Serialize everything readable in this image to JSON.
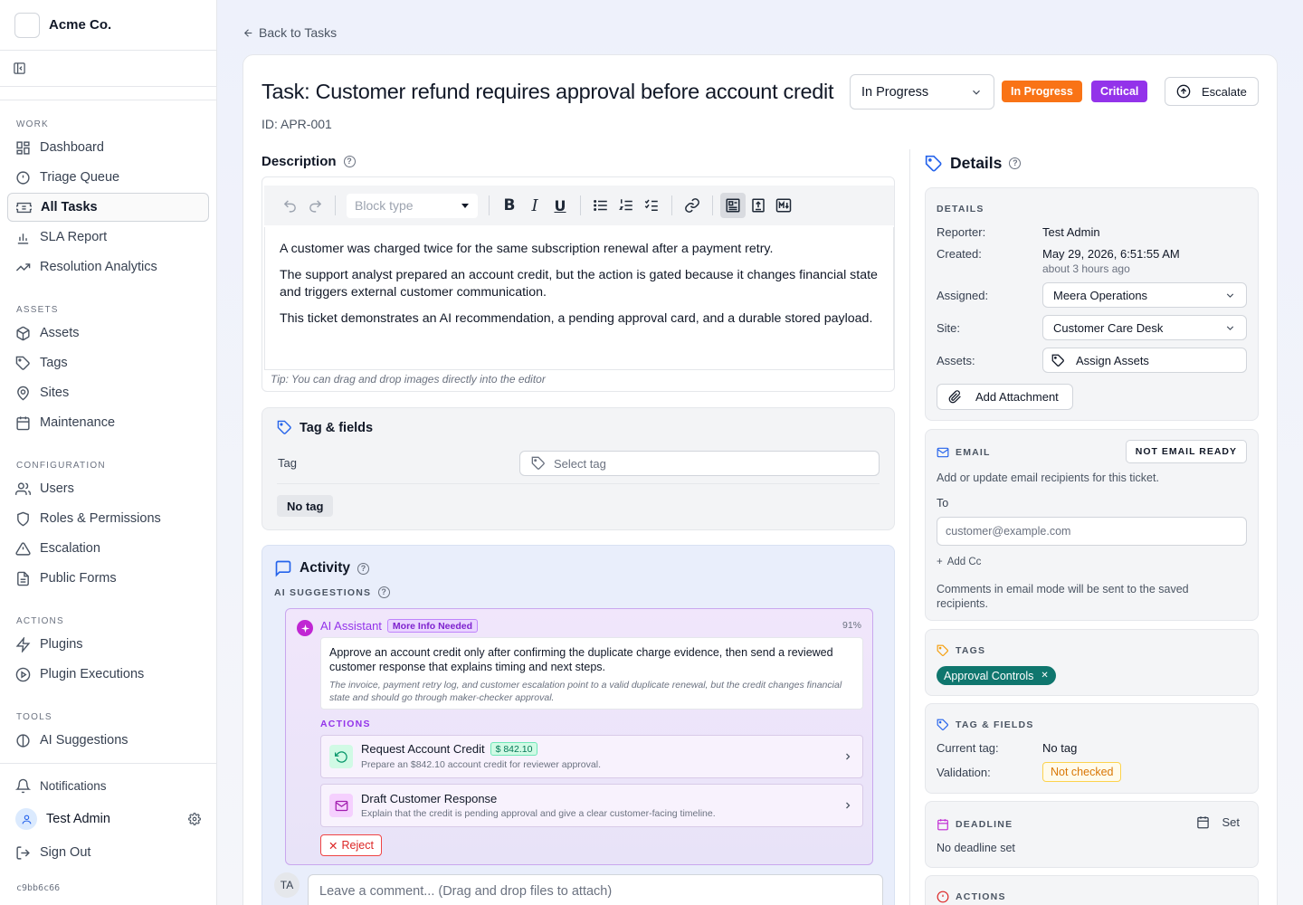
{
  "app": {
    "name": "Acme Co.",
    "build_hash": "c9bb6c66"
  },
  "sidebar": {
    "sections": [
      {
        "title": "WORK",
        "items": [
          {
            "label": "Dashboard",
            "icon": "dashboard-icon"
          },
          {
            "label": "Triage Queue",
            "icon": "alert-circle-icon"
          },
          {
            "label": "All Tasks",
            "icon": "ticket-icon",
            "active": true
          },
          {
            "label": "SLA Report",
            "icon": "bar-chart-icon"
          },
          {
            "label": "Resolution Analytics",
            "icon": "trending-up-icon"
          }
        ]
      },
      {
        "title": "ASSETS",
        "items": [
          {
            "label": "Assets",
            "icon": "box-icon"
          },
          {
            "label": "Tags",
            "icon": "tag-icon"
          },
          {
            "label": "Sites",
            "icon": "map-pin-icon"
          },
          {
            "label": "Maintenance",
            "icon": "calendar-icon"
          }
        ]
      },
      {
        "title": "CONFIGURATION",
        "items": [
          {
            "label": "Users",
            "icon": "users-icon"
          },
          {
            "label": "Roles & Permissions",
            "icon": "shield-icon"
          },
          {
            "label": "Escalation",
            "icon": "warning-triangle-icon"
          },
          {
            "label": "Public Forms",
            "icon": "file-text-icon"
          }
        ]
      },
      {
        "title": "ACTIONS",
        "items": [
          {
            "label": "Plugins",
            "icon": "zap-icon"
          },
          {
            "label": "Plugin Executions",
            "icon": "play-circle-icon"
          }
        ]
      },
      {
        "title": "TOOLS",
        "items": [
          {
            "label": "AI Suggestions",
            "icon": "ai-icon"
          }
        ]
      }
    ],
    "notifications_label": "Notifications",
    "user_name": "Test Admin",
    "sign_out_label": "Sign Out"
  },
  "header": {
    "back_label": "Back to Tasks",
    "title": "Task: Customer refund requires approval before account credit",
    "task_id": "ID: APR-001",
    "status_select_value": "In Progress",
    "status_badge": "In Progress",
    "priority_badge": "Critical",
    "escalate_label": "Escalate",
    "colors": {
      "status": "#f97316",
      "priority": "#9333ea"
    }
  },
  "description": {
    "title": "Description",
    "block_type_placeholder": "Block type",
    "paragraphs": [
      "A customer was charged twice for the same subscription renewal after a payment retry.",
      "The support analyst prepared an account credit, but the action is gated because it changes financial state and triggers external customer communication.",
      "This ticket demonstrates an AI recommendation, a pending approval card, and a durable stored payload."
    ],
    "tip": "Tip: You can drag and drop images directly into the editor"
  },
  "tag_fields": {
    "title": "Tag & fields",
    "tag_label": "Tag",
    "select_placeholder": "Select tag",
    "no_tag_label": "No tag"
  },
  "activity": {
    "title": "Activity",
    "suggestions_label": "AI SUGGESTIONS",
    "assistant_name": "AI Assistant",
    "assistant_badge": "More Info Needed",
    "confidence": "91%",
    "recommendation": "Approve an account credit only after confirming the duplicate charge evidence, then send a reviewed customer response that explains timing and next steps.",
    "rationale": "The invoice, payment retry log, and customer escalation point to a valid duplicate renewal, but the credit changes financial state and should go through maker-checker approval.",
    "actions_label": "ACTIONS",
    "actions": [
      {
        "title": "Request Account Credit",
        "amount": "$ 842.10",
        "desc": "Prepare an $842.10 account credit for reviewer approval."
      },
      {
        "title": "Draft Customer Response",
        "desc": "Explain that the credit is pending approval and give a clear customer-facing timeline."
      }
    ],
    "reject_label": "Reject",
    "comment_avatar": "TA",
    "comment_placeholder": "Leave a comment... (Drag and drop files to attach)"
  },
  "details": {
    "title": "Details",
    "section_label": "DETAILS",
    "reporter_label": "Reporter:",
    "reporter": "Test Admin",
    "created_label": "Created:",
    "created": "May 29, 2026, 6:51:55 AM",
    "created_relative": "about 3 hours ago",
    "assigned_label": "Assigned:",
    "assigned": "Meera Operations",
    "site_label": "Site:",
    "site": "Customer Care Desk",
    "assets_label": "Assets:",
    "assets_button": "Assign Assets",
    "attachment_button": "Add Attachment"
  },
  "email": {
    "label": "EMAIL",
    "status": "NOT EMAIL READY",
    "hint": "Add or update email recipients for this ticket.",
    "to_label": "To",
    "to_placeholder": "customer@example.com",
    "add_cc": "Add Cc",
    "note": "Comments in email mode will be sent to the saved recipients."
  },
  "tags": {
    "label": "TAGS",
    "items": [
      "Approval Controls"
    ],
    "tag_color": "#0f766e"
  },
  "tag_fields_panel": {
    "label": "TAG & FIELDS",
    "current_label": "Current tag:",
    "current": "No tag",
    "validation_label": "Validation:",
    "validation": "Not checked"
  },
  "deadline": {
    "label": "DEADLINE",
    "set_label": "Set",
    "value": "No deadline set"
  },
  "actions_panel": {
    "label": "ACTIONS"
  }
}
